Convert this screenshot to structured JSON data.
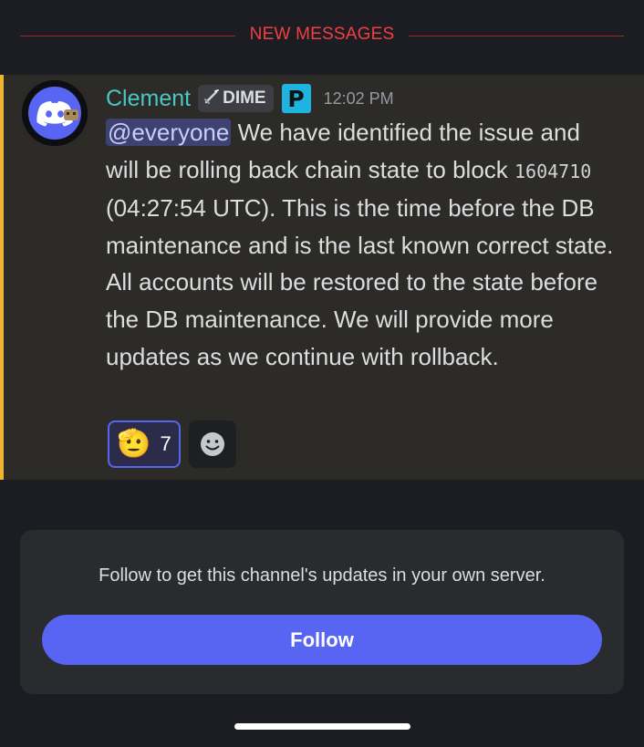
{
  "divider": {
    "label": "NEW MESSAGES",
    "color": "#f23f43"
  },
  "message": {
    "avatar": {
      "icon": "discord-logo-icon",
      "bg": "#5865f2"
    },
    "author": "Clement",
    "author_color": "#49c7c4",
    "tag": {
      "icon": "sword-icon",
      "label": "DIME"
    },
    "app_icon": {
      "name": "p-logo-icon",
      "letter": "P",
      "color": "#1fb3e0"
    },
    "timestamp": "12:02 PM",
    "mention": "@everyone",
    "text_1": " We have identified the issue and will be rolling back chain state to block ",
    "block_number": "1604710",
    "text_2": " (04:27:54 UTC). This is the time before the DB maintenance and is the last known correct state. All accounts will be restored to the state before the DB maintenance. We will provide more updates as we continue with rollback.",
    "accent_color": "#f0b232"
  },
  "reactions": [
    {
      "emoji": "🫡",
      "icon": "saluting-face-icon",
      "count": "7"
    }
  ],
  "add_reaction_icon": "add-reaction-icon",
  "follow": {
    "text": "Follow to get this channel's updates in your own server.",
    "button_label": "Follow",
    "button_color": "#5865f2"
  }
}
